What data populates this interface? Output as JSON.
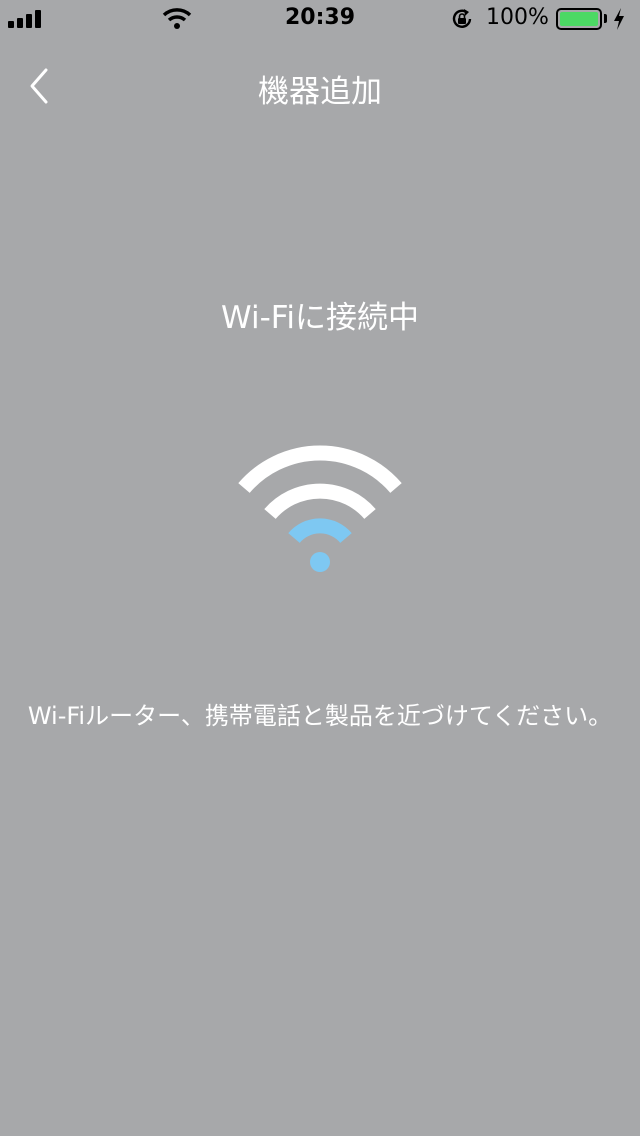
{
  "status_bar": {
    "time": "20:39",
    "battery_percent": "100%",
    "battery_level": 1.0,
    "signal_bars": 4,
    "battery_color": "#4cd964"
  },
  "nav": {
    "back_icon": "chevron-left-icon",
    "title": "機器追加"
  },
  "main": {
    "heading": "Wi-Fiに接続中",
    "graphic_icon": "wifi-icon",
    "active_color": "#7ec8f2",
    "instruction": "Wi-Fiルーター、携帯電話と製品を近づけてください。"
  },
  "colors": {
    "background": "#a7a8aa",
    "text": "#ffffff"
  }
}
